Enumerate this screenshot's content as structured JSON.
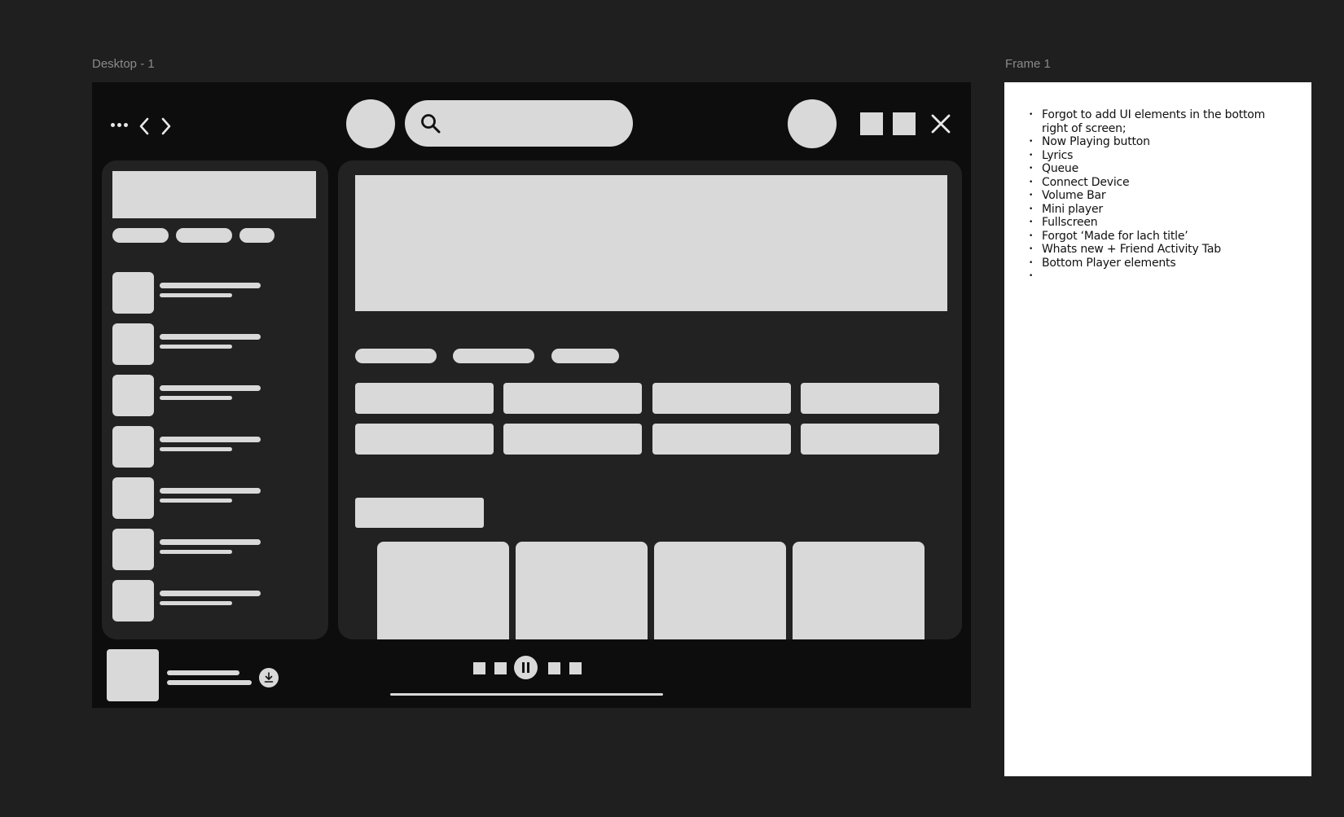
{
  "canvas": {
    "frames": [
      {
        "label": "Desktop - 1"
      },
      {
        "label": "Frame 1"
      }
    ]
  },
  "desktop": {
    "topbar": {
      "icons": [
        "more-dots-icon",
        "chevron-left-icon",
        "chevron-right-icon",
        "search-icon",
        "minimize-icon",
        "maximize-icon",
        "close-icon"
      ]
    },
    "player": {
      "icons": [
        "download-icon",
        "pause-icon"
      ]
    }
  },
  "notes": {
    "items": [
      "Forgot to add UI elements in the bottom right of screen;",
      "Now Playing button",
      "Lyrics",
      "Queue",
      "Connect Device",
      "Volume Bar",
      "Mini player",
      "Fullscreen",
      "Forgot ‘Made for lach title’",
      "Whats new + Friend Activity Tab",
      "Bottom Player elements",
      ""
    ]
  },
  "colors": {
    "canvas_bg": "#1f1f1f",
    "frame_bg": "#0d0d0d",
    "panel_bg": "#222222",
    "placeholder": "#d9d9d9",
    "note_bg": "#ffffff"
  }
}
